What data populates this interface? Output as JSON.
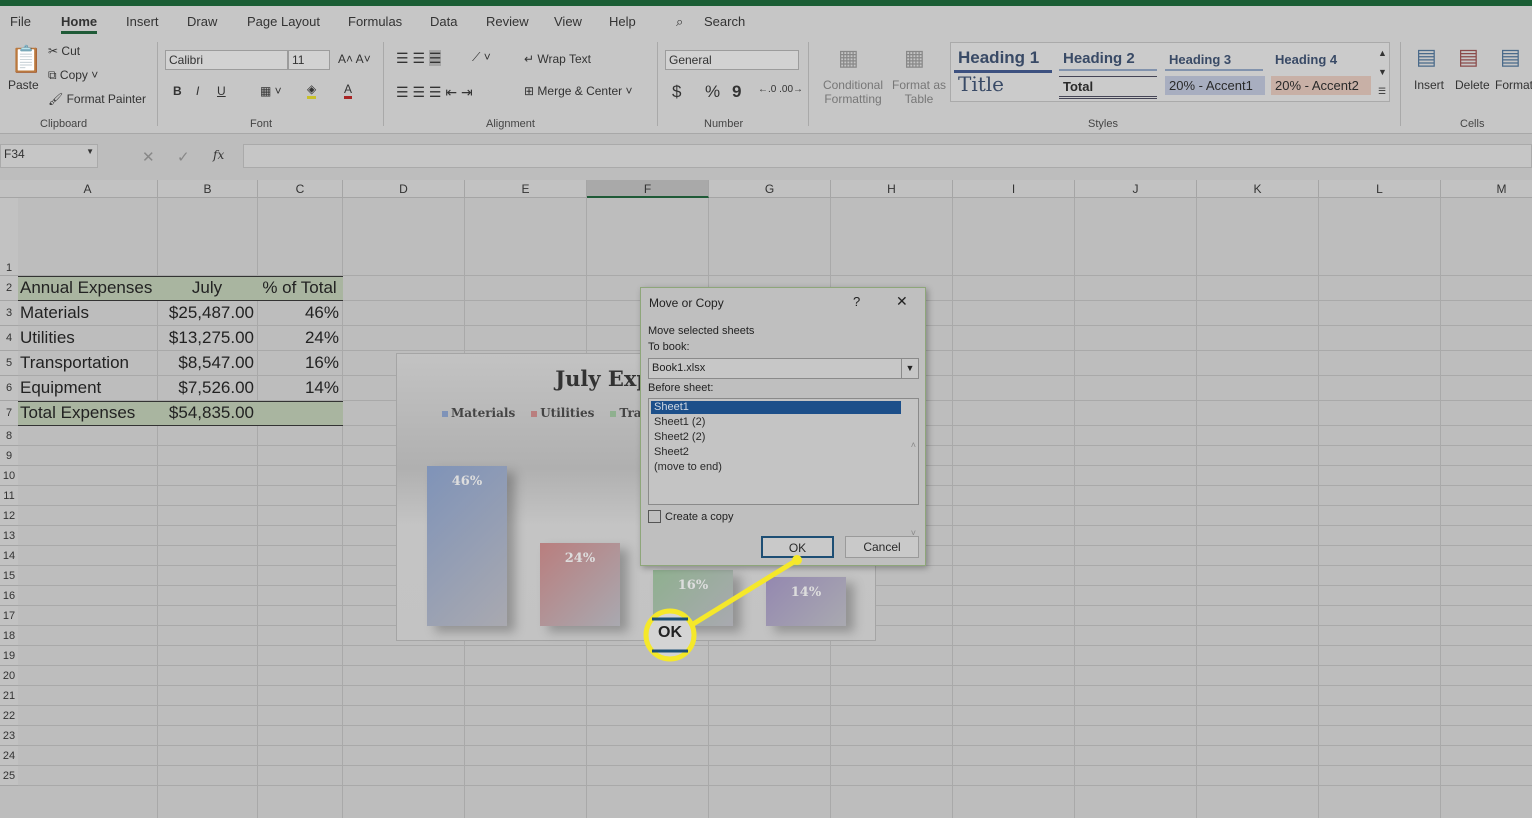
{
  "ribbon_tabs": [
    "File",
    "Home",
    "Insert",
    "Draw",
    "Page Layout",
    "Formulas",
    "Data",
    "Review",
    "View",
    "Help"
  ],
  "search_label": "Search",
  "clipboard": {
    "paste": "Paste",
    "cut": "Cut",
    "copy": "Copy",
    "format_painter": "Format Painter",
    "group": "Clipboard"
  },
  "font": {
    "name": "Calibri",
    "size": "11",
    "bold": "B",
    "italic": "I",
    "underline": "U",
    "group": "Font"
  },
  "alignment": {
    "wrap": "Wrap Text",
    "merge": "Merge & Center",
    "group": "Alignment"
  },
  "number": {
    "format": "General",
    "currency": "$",
    "percent": "%",
    "comma": "9",
    "group": "Number"
  },
  "styles": {
    "conditional": "Conditional Formatting",
    "format_table": "Format as Table",
    "items": [
      "Heading 1",
      "Heading 2",
      "Heading 3",
      "Heading 4",
      "Title",
      "Total",
      "20% - Accent1",
      "20% - Accent2"
    ],
    "group": "Styles"
  },
  "cells": {
    "insert": "Insert",
    "delete": "Delete",
    "format": "Format",
    "group": "Cells"
  },
  "name_box": "F34",
  "fx": "fx",
  "columns": [
    "A",
    "B",
    "C",
    "D",
    "E",
    "F",
    "G",
    "H",
    "I",
    "J",
    "K",
    "L",
    "M"
  ],
  "rows": [
    "1",
    "2",
    "3",
    "4",
    "5",
    "6",
    "7",
    "8",
    "9",
    "10",
    "11",
    "12",
    "13",
    "14",
    "15",
    "16",
    "17",
    "18",
    "19",
    "20",
    "21",
    "22",
    "23",
    "24",
    "25"
  ],
  "table": {
    "headers": [
      "Annual Expenses",
      "July",
      "% of Total"
    ],
    "rows": [
      [
        "Materials",
        "$25,487.00",
        "46%"
      ],
      [
        "Utilities",
        "$13,275.00",
        "24%"
      ],
      [
        "Transportation",
        "$8,547.00",
        "16%"
      ],
      [
        "Equipment",
        "$7,526.00",
        "14%"
      ]
    ],
    "total": [
      "Total Expenses",
      "$54,835.00",
      ""
    ]
  },
  "chart_data": {
    "type": "bar",
    "title": "July Expenses",
    "categories": [
      "Materials",
      "Utilities",
      "Transportation",
      "Equipment"
    ],
    "values": [
      46,
      24,
      16,
      14
    ],
    "data_labels": [
      "46%",
      "24%",
      "16%",
      "14%"
    ],
    "colors": [
      "#7f93b8",
      "#b97e7e",
      "#8fb08f",
      "#9488b0"
    ],
    "legend": "top",
    "grid": false
  },
  "dialog": {
    "title": "Move or Copy",
    "help": "?",
    "close": "✕",
    "move_label": "Move selected sheets",
    "to_book_label": "To book:",
    "to_book_value": "Book1.xlsx",
    "before_label": "Before sheet:",
    "sheets": [
      "Sheet1",
      "Sheet1 (2)",
      "Sheet2 (2)",
      "Sheet2",
      "(move to end)"
    ],
    "selected": "Sheet1",
    "copy_label": "Create a copy",
    "copy_checked": false,
    "ok": "OK",
    "cancel": "Cancel"
  },
  "callout": {
    "label": "OK",
    "color": "#f5e82a"
  }
}
